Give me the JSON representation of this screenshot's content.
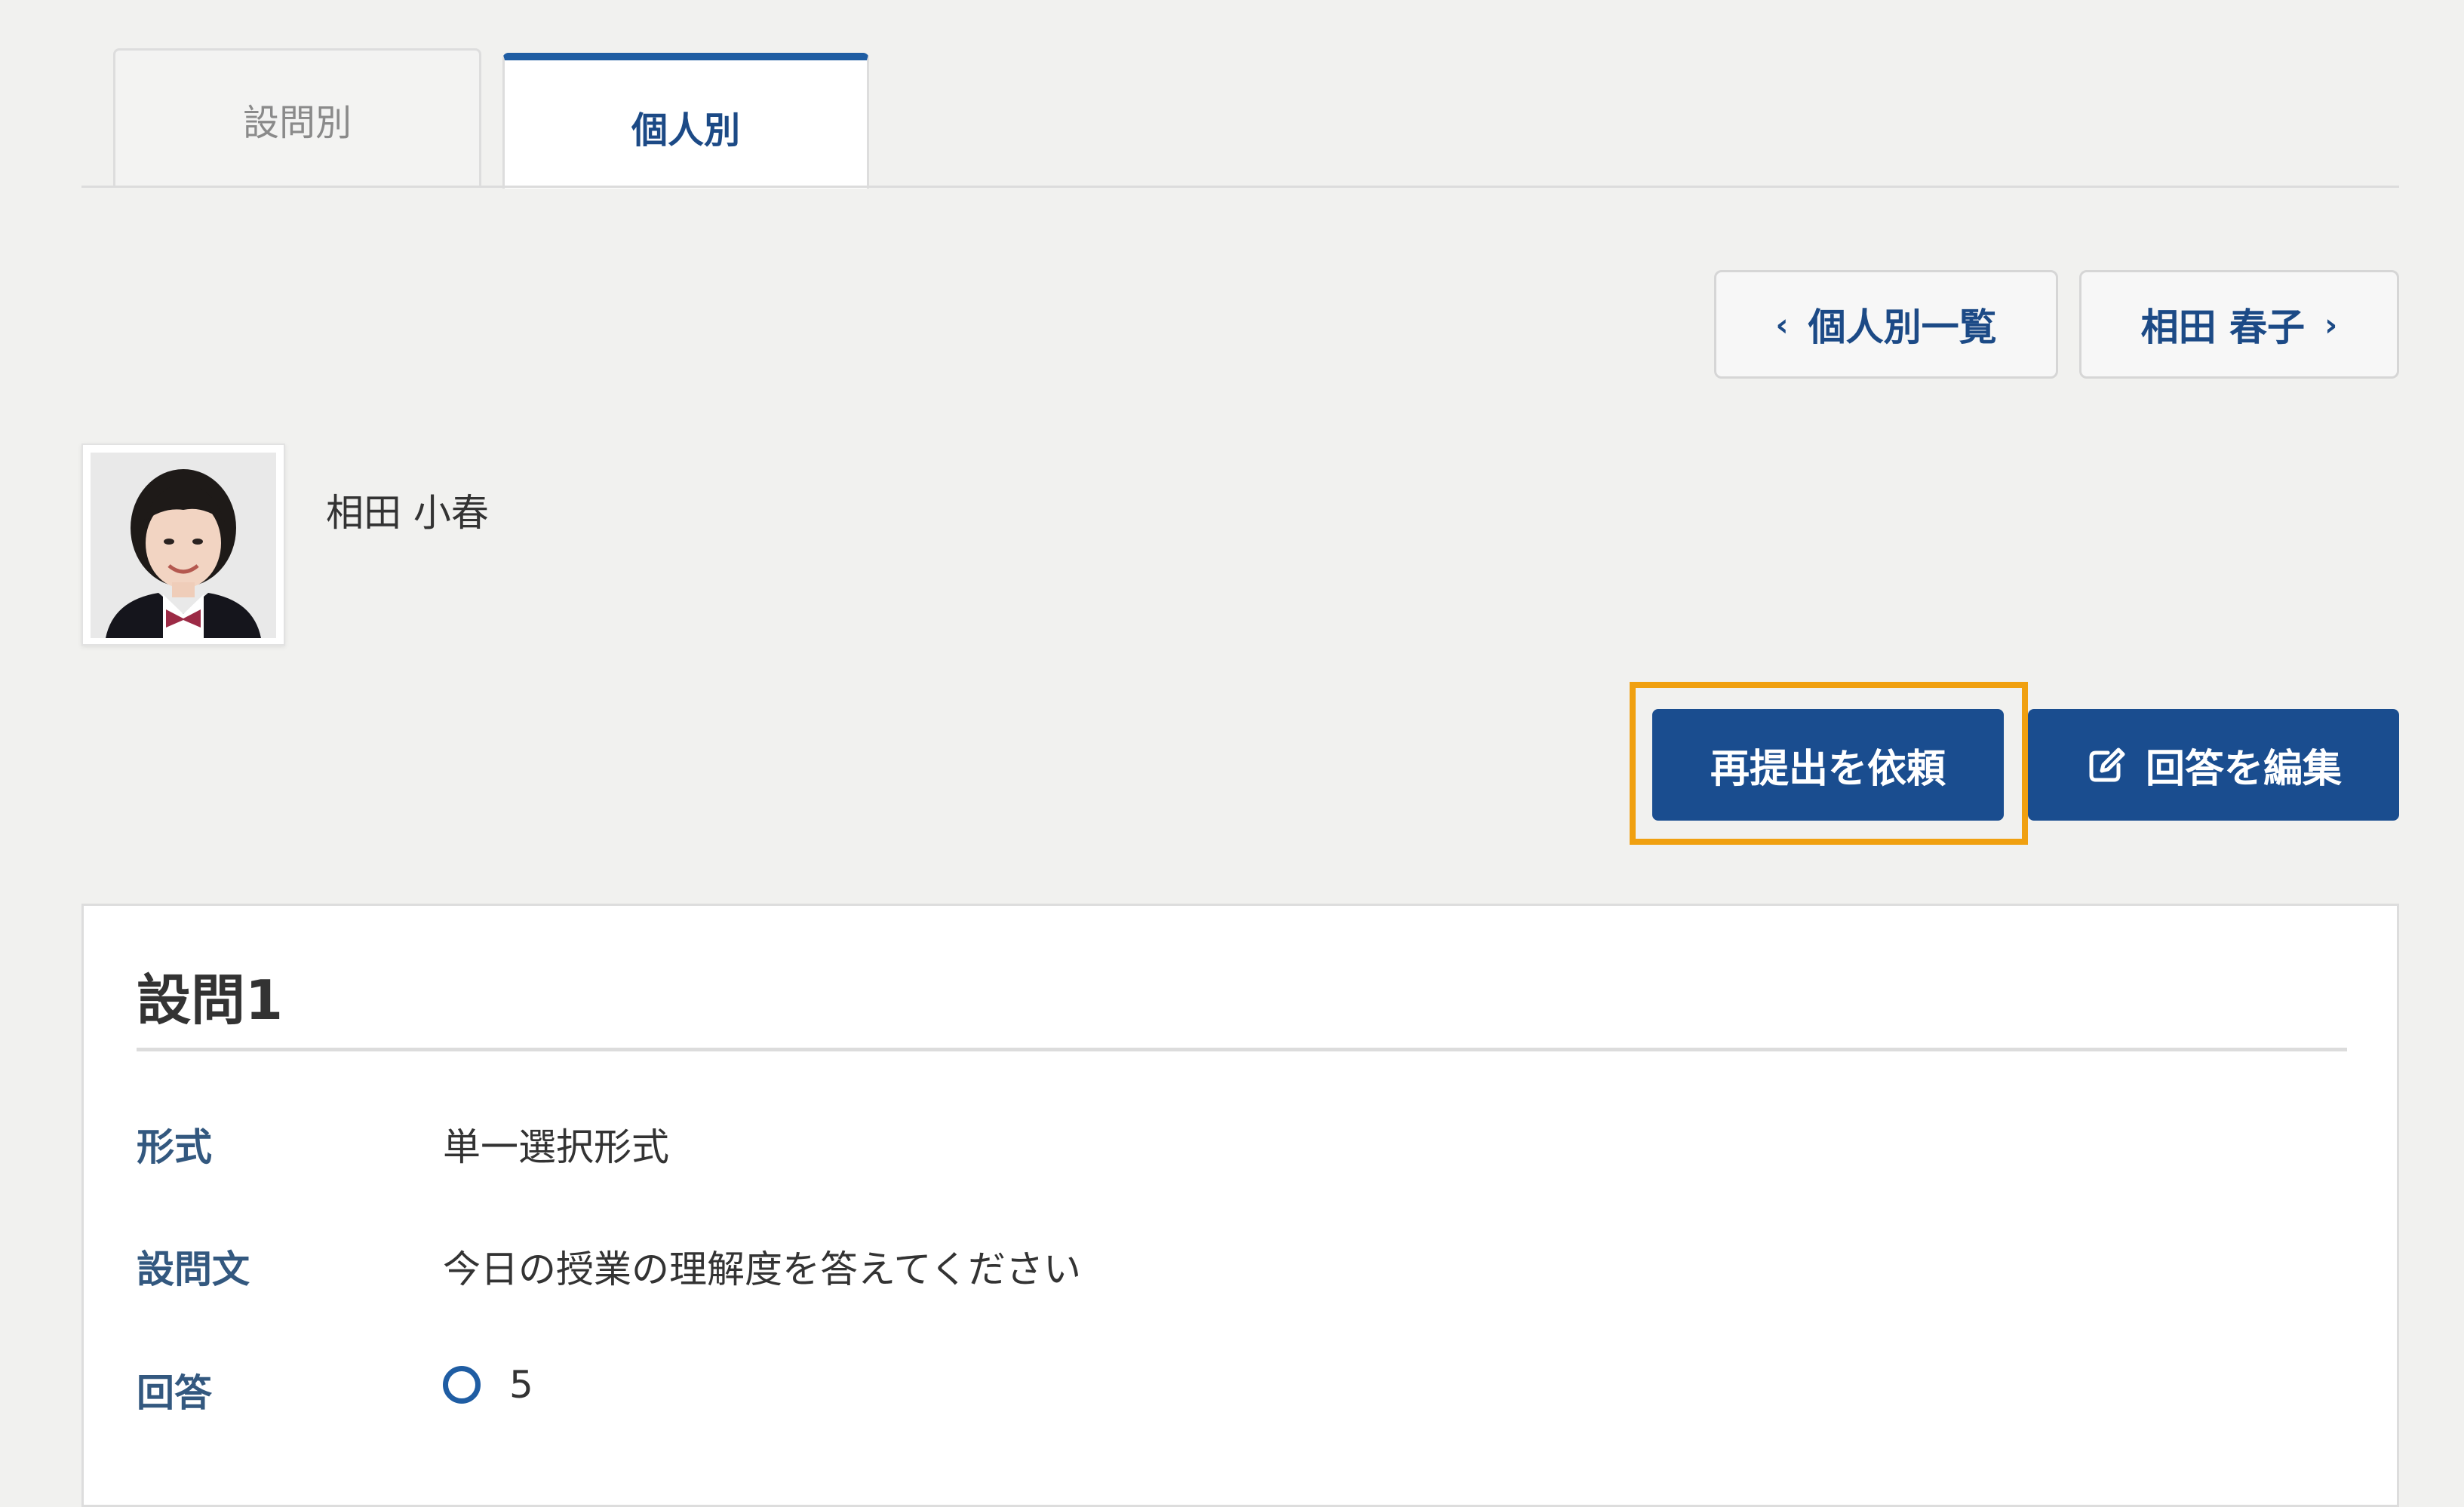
{
  "tabs": [
    {
      "label": "設問別",
      "active": false
    },
    {
      "label": "個人別",
      "active": true
    }
  ],
  "nav": {
    "prev_label": "個人別一覧",
    "next_label": "相田 春子",
    "prev_icon": "chevron-left-icon",
    "next_icon": "chevron-right-icon"
  },
  "student": {
    "name": "相田 小春"
  },
  "actions": {
    "resubmit_label": "再提出を依頼",
    "edit_label": "回答を編集",
    "edit_icon": "edit-icon"
  },
  "question": {
    "title": "設問1",
    "format_label": "形式",
    "format_value": "単一選択形式",
    "text_label": "設問文",
    "text_value": "今日の授業の理解度を答えてください",
    "answer_label": "回答",
    "answer_value": "5",
    "answer_icon": "radio-selected-icon"
  },
  "colors": {
    "accent": "#1a4d8f",
    "tab_active_border": "#1f5da3",
    "focus_ring": "#f0a010",
    "label_text": "#33587f",
    "background": "#f1f1ef"
  }
}
